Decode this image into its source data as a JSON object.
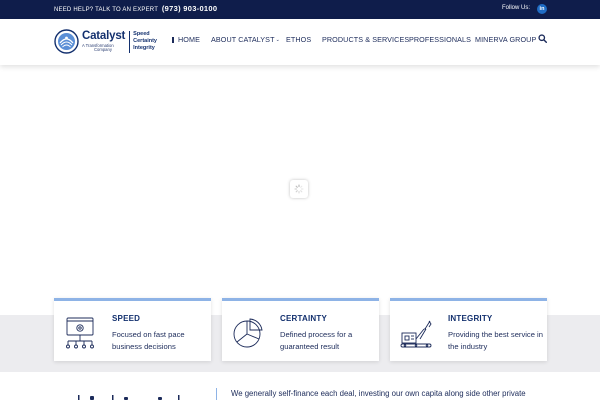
{
  "topbar": {
    "help_text": "NEED HELP? TALK TO AN EXPERT",
    "phone": "(973) 903-0100",
    "follow_label": "Follow Us:",
    "linkedin_label": "in"
  },
  "logo": {
    "brand": "Catalyst",
    "subtitle_line1": "A Transformation",
    "subtitle_line2": "Company",
    "tagline": [
      "Speed",
      "Certainty",
      "Integrity"
    ]
  },
  "nav": {
    "items": [
      {
        "label": "HOME"
      },
      {
        "label": "ABOUT CATALYST"
      },
      {
        "label": "ETHOS"
      },
      {
        "label": "PRODUCTS & SERVICES"
      },
      {
        "label": "PROFESSIONALS"
      },
      {
        "label": "MINERVA GROUP"
      }
    ],
    "icons": {
      "search": "search-icon",
      "dropdown": "chevron-down-icon"
    }
  },
  "features": [
    {
      "title": "SPEED",
      "description": "Focused on fast pace business decisions",
      "icon": "monitor-gear-network-icon"
    },
    {
      "title": "CERTAINTY",
      "description": "Defined process for a guaranteed result",
      "icon": "pie-chart-icon"
    },
    {
      "title": "INTEGRITY",
      "description": "Providing the best service in the industry",
      "icon": "crane-icon"
    }
  ],
  "intro_text": "We generally self-finance each deal, investing our own capita along side other private",
  "colors": {
    "navy": "#0f1d4b",
    "brand_blue": "#13306e",
    "accent": "#8eb3e6",
    "linkedin": "#1f6cc4",
    "band": "#ececef"
  }
}
